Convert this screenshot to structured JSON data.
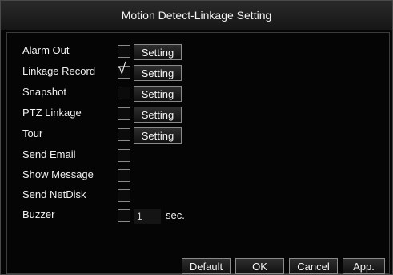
{
  "window": {
    "title": "Motion Detect-Linkage Setting"
  },
  "rows": [
    {
      "label": "Alarm Out",
      "checked": false,
      "has_setting": true
    },
    {
      "label": "Linkage Record",
      "checked": true,
      "has_setting": true
    },
    {
      "label": "Snapshot",
      "checked": false,
      "has_setting": true
    },
    {
      "label": "PTZ Linkage",
      "checked": false,
      "has_setting": true
    },
    {
      "label": "Tour",
      "checked": false,
      "has_setting": true
    },
    {
      "label": "Send Email",
      "checked": false,
      "has_setting": false
    },
    {
      "label": "Show Message",
      "checked": false,
      "has_setting": false
    },
    {
      "label": "Send NetDisk",
      "checked": false,
      "has_setting": false
    },
    {
      "label": "Buzzer",
      "checked": false,
      "has_setting": false
    }
  ],
  "setting_label": "Setting",
  "check_glyph": "√",
  "buzzer": {
    "value": "1",
    "unit": "sec."
  },
  "footer": {
    "default_label": "Default",
    "ok_label": "OK",
    "cancel_label": "Cancel",
    "apply_label": "App."
  }
}
